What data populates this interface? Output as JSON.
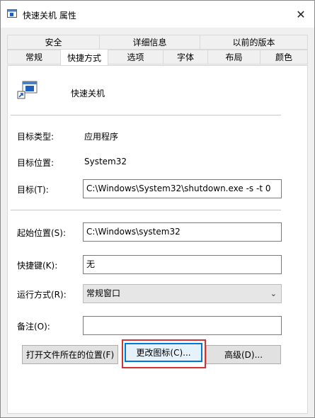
{
  "window": {
    "title": "快速关机 属性",
    "close_glyph": "✕"
  },
  "tabs": {
    "row_top": [
      "安全",
      "详细信息",
      "以前的版本"
    ],
    "row_bottom": [
      "常规",
      "快捷方式",
      "选项",
      "字体",
      "布局",
      "颜色"
    ],
    "active": "快捷方式"
  },
  "shortcut": {
    "name": "快速关机"
  },
  "fields": {
    "target_type": {
      "label": "目标类型:",
      "value": "应用程序"
    },
    "target_location": {
      "label": "目标位置:",
      "value": "System32"
    },
    "target": {
      "label": "目标(T):",
      "value": "C:\\Windows\\System32\\shutdown.exe -s -t 0"
    },
    "start_in": {
      "label": "起始位置(S):",
      "value": "C:\\Windows\\system32"
    },
    "shortcut_key": {
      "label": "快捷键(K):",
      "value": "无"
    },
    "run": {
      "label": "运行方式(R):",
      "value": "常规窗口"
    },
    "comment": {
      "label": "备注(O):",
      "value": ""
    }
  },
  "buttons": {
    "open_location": "打开文件所在的位置(F)",
    "change_icon": "更改图标(C)...",
    "advanced": "高级(D)..."
  },
  "colors": {
    "focus": "#0078d7",
    "highlight": "#d43232"
  }
}
